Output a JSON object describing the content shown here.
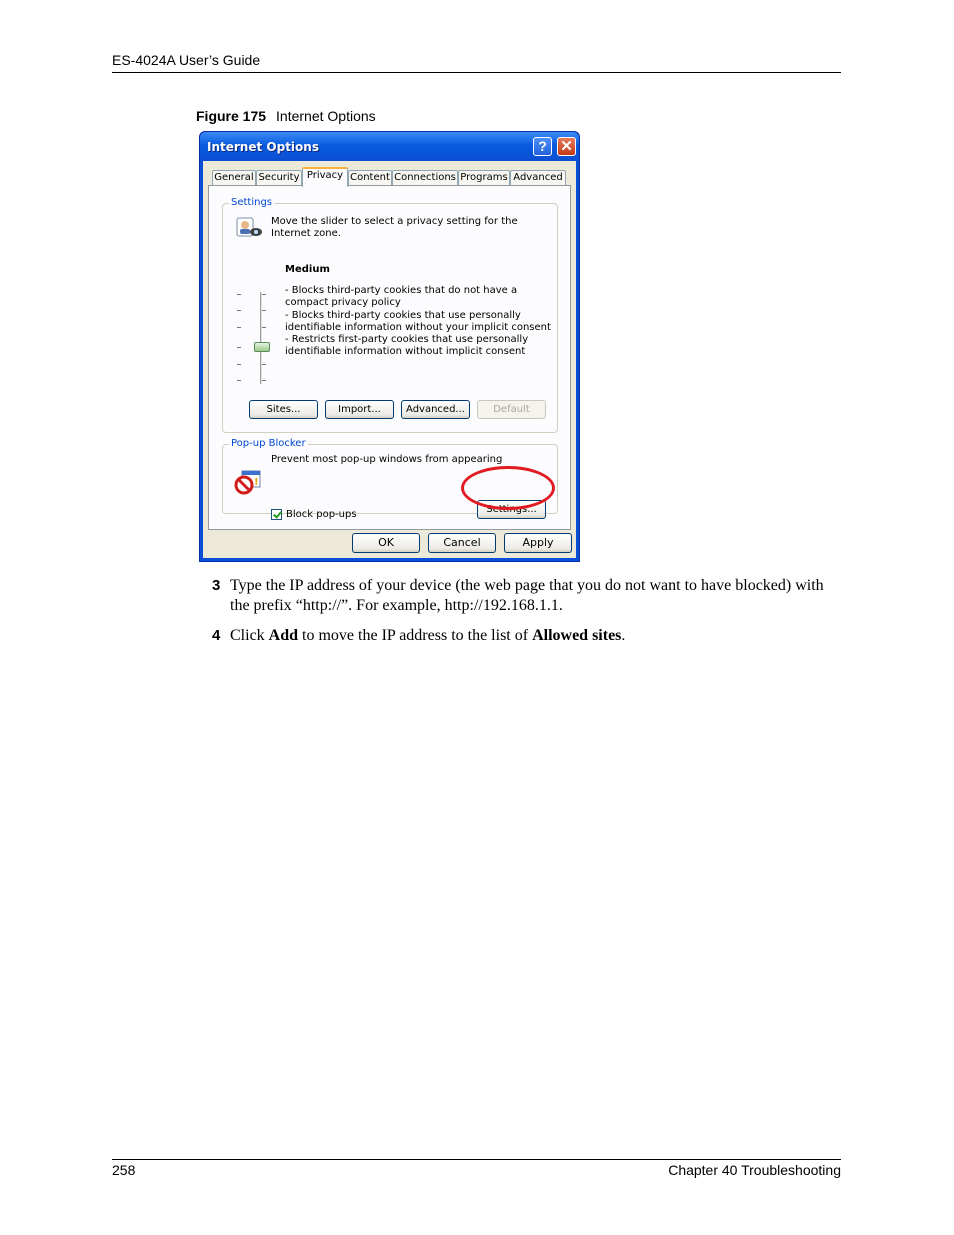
{
  "page": {
    "header": "ES-4024A User’s Guide",
    "footer_left": "258",
    "footer_right": "Chapter 40 Troubleshooting"
  },
  "figure": {
    "label": "Figure 175",
    "title": "Internet Options"
  },
  "dialog": {
    "title": "Internet Options",
    "help_glyph": "?",
    "close_glyph": "✕",
    "tabs": [
      "General",
      "Security",
      "Privacy",
      "Content",
      "Connections",
      "Programs",
      "Advanced"
    ],
    "active_tab": "Privacy",
    "settings_group": {
      "label": "Settings",
      "instruction": "Move the slider to select a privacy setting for the Internet zone.",
      "level": "Medium",
      "bullets": [
        "- Blocks third-party cookies that do not have a compact privacy policy",
        "- Blocks third-party cookies that use personally identifiable information without your implicit consent",
        "- Restricts first-party cookies that use personally identifiable information without implicit consent"
      ],
      "buttons": [
        "Sites...",
        "Import...",
        "Advanced...",
        "Default"
      ]
    },
    "popup_group": {
      "label": "Pop-up Blocker",
      "description": "Prevent most pop-up windows from appearing",
      "checkbox_label": "Block pop-ups",
      "checkbox_checked": true,
      "settings_button": "Settings..."
    },
    "footer_buttons": [
      "OK",
      "Cancel",
      "Apply"
    ]
  },
  "steps": [
    {
      "num": "3",
      "text_pre": "Type the IP address of your device (the web page that you do not want to have blocked) with the prefix “http://”. For example, http://192.168.1.1."
    },
    {
      "num": "4",
      "text_pre": "Click ",
      "bold1": "Add",
      "text_mid": " to move the IP address to the list of ",
      "bold2": "Allowed sites",
      "text_post": "."
    }
  ],
  "colors": {
    "title_bar": "#0a5ae0",
    "dialog_face": "#ece9d8",
    "group_label": "#0046d5",
    "highlight_ring": "#e11b22"
  }
}
